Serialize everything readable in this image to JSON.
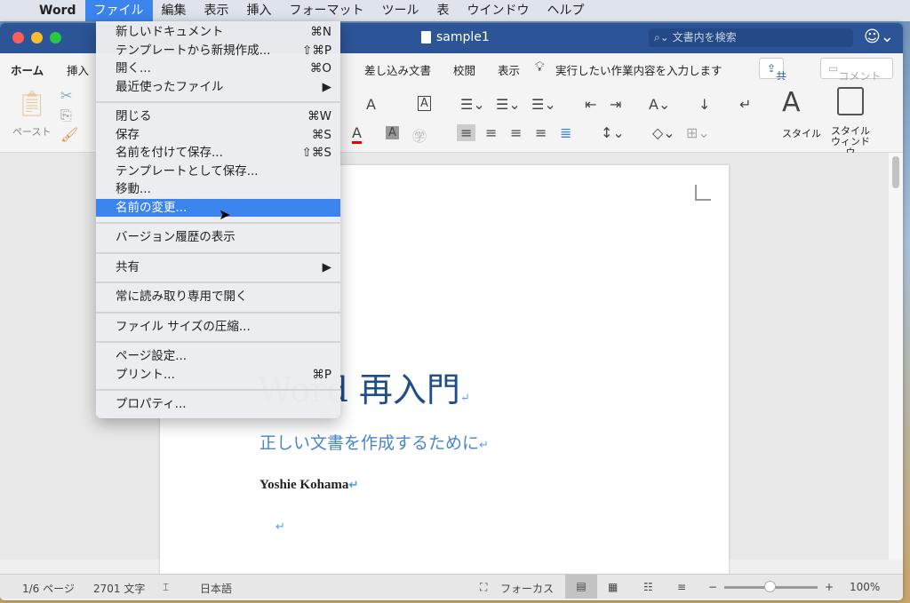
{
  "menubar": {
    "app": "Word",
    "items": [
      "ファイル",
      "編集",
      "表示",
      "挿入",
      "フォーマット",
      "ツール",
      "表",
      "ウインドウ",
      "ヘルプ"
    ]
  },
  "window": {
    "title": "sample1",
    "search_placeholder": "文書内を検索"
  },
  "tabs": {
    "home": "ホーム",
    "insert": "挿入",
    "mailings": "差し込み文書",
    "review": "校閲",
    "view": "表示",
    "tell_me": "実行したい作業内容を入力します",
    "share": "共有",
    "comment": "コメント"
  },
  "ribbon": {
    "paste": "ペースト",
    "styles": "スタイル",
    "styles_pane": "スタイル ウィンドウ"
  },
  "document": {
    "title": "Word 再入門",
    "subtitle": "正しい文書を作成するために",
    "author": "Yoshie Kohama"
  },
  "status": {
    "page": "1/6 ページ",
    "words": "2701 文字",
    "language": "日本語",
    "focus": "フォーカス",
    "zoom": "100%",
    "zoom_percent": 100
  },
  "file_menu": {
    "items": [
      {
        "label": "新しいドキュメント",
        "shortcut": "⌘N"
      },
      {
        "label": "テンプレートから新規作成...",
        "shortcut": "⇧⌘P"
      },
      {
        "label": "開く...",
        "shortcut": "⌘O"
      },
      {
        "label": "最近使ったファイル",
        "shortcut": "▶"
      },
      {
        "label": "閉じる",
        "shortcut": "⌘W"
      },
      {
        "label": "保存",
        "shortcut": "⌘S"
      },
      {
        "label": "名前を付けて保存...",
        "shortcut": "⇧⌘S"
      },
      {
        "label": "テンプレートとして保存..."
      },
      {
        "label": "移動..."
      },
      {
        "label": "名前の変更...",
        "highlighted": true
      },
      {
        "label": "バージョン履歴の表示"
      },
      {
        "label": "共有",
        "shortcut": "▶"
      },
      {
        "label": "常に読み取り専用で開く"
      },
      {
        "label": "ファイル サイズの圧縮..."
      },
      {
        "label": "ページ設定..."
      },
      {
        "label": "プリント...",
        "shortcut": "⌘P"
      },
      {
        "label": "プロパティ..."
      }
    ]
  },
  "colors": {
    "accent": "#3b84ee",
    "titlebar": "#2c5597",
    "doc_title": "#1f4e89",
    "doc_subtitle": "#4a86c8"
  }
}
